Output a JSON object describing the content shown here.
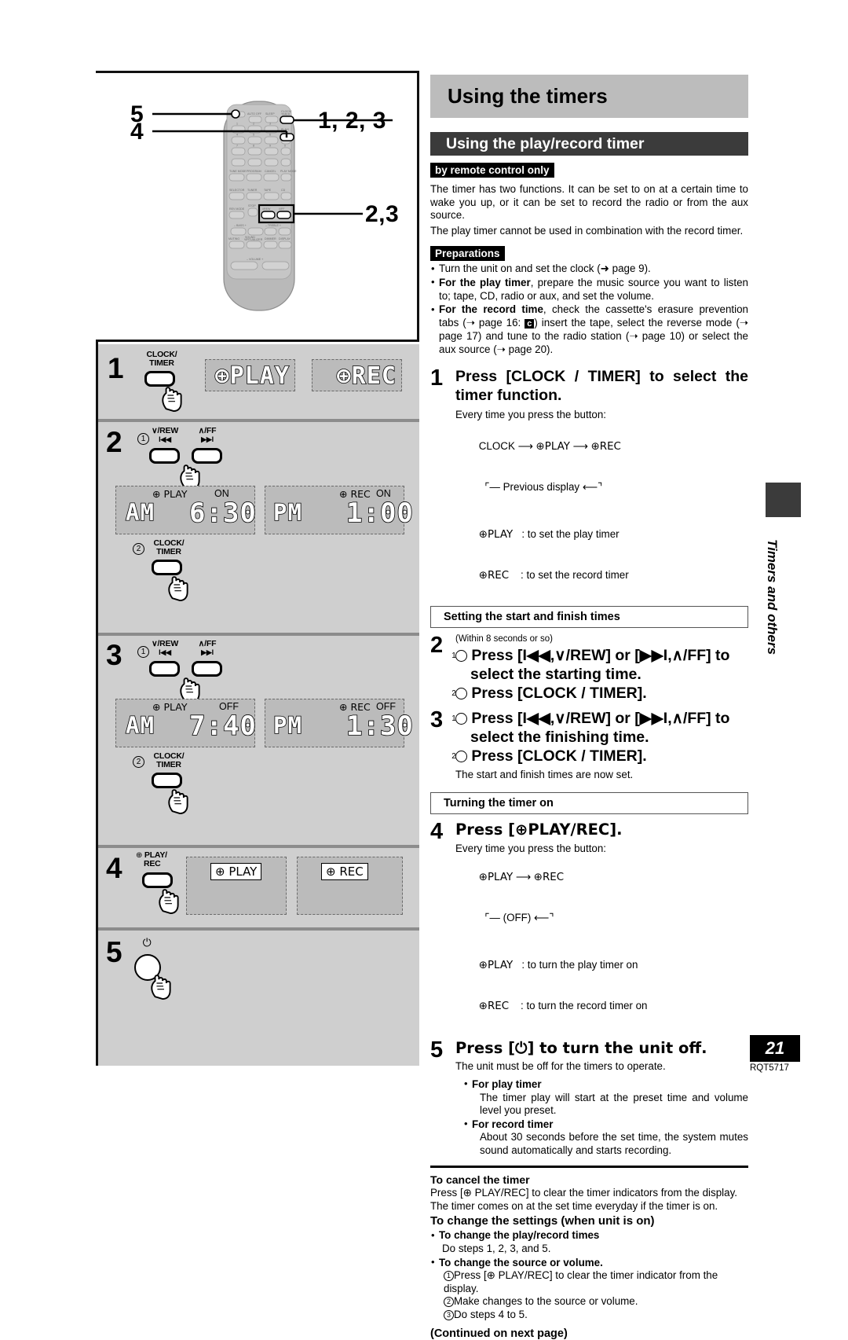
{
  "page": {
    "number": "21",
    "doc_code": "RQT5717",
    "side_tab_label": "Timers and others"
  },
  "header": {
    "title": "Using the timers",
    "subtitle": "Using the play/record timer",
    "badge": "by remote control only"
  },
  "intro": {
    "p1": "The timer has two functions. It can be set to on at a certain time to wake you up, or it can be set to record the radio or from the aux source.",
    "p2": "The play timer cannot be used in combination with the record timer."
  },
  "preparations": {
    "label": "Preparations",
    "items": [
      "Turn the unit on and set the clock (➜ page 9).",
      "For the play timer, prepare the music source you want to listen to; tape, CD, radio or aux, and set the volume.",
      "For the record time, check the cassette's erasure prevention tabs (➜ page 16: c ) insert the tape, select the reverse mode (➜ page 17) and tune to the radio station (➜ page 10) or select the aux source (➜ page 20)."
    ],
    "bold_leads": [
      "",
      "For the play timer",
      "For the record time"
    ]
  },
  "step1": {
    "num": "1",
    "heading": "Press [CLOCK / TIMER] to select the timer function.",
    "note": "Every time you press the button:",
    "cycle_a": "CLOCK",
    "cycle_b": "⊕PLAY",
    "cycle_c": "⊕REC",
    "cycle_back": "Previous display",
    "legend": [
      {
        "key": "⊕PLAY",
        "val": ": to set the play timer"
      },
      {
        "key": "⊕REC",
        "val": ": to set the record timer"
      }
    ]
  },
  "section_times": {
    "header": "Setting the start and finish times"
  },
  "step2": {
    "num": "2",
    "small": "(Within 8 seconds or so)",
    "sub1": "Press [I◀◀,∨/REW] or  [▶▶I,∧/FF] to select the starting time.",
    "sub2": "Press [CLOCK / TIMER]."
  },
  "step3": {
    "num": "3",
    "sub1": "Press [I◀◀,∨/REW] or  [▶▶I,∧/FF] to select the finishing time.",
    "sub2": "Press [CLOCK / TIMER].",
    "note": "The start and finish times are now set."
  },
  "section_turnon": {
    "header": "Turning the timer on"
  },
  "step4": {
    "num": "4",
    "heading": "Press [⊕PLAY/REC].",
    "note": "Every time you press the button:",
    "cycle_a": "⊕PLAY",
    "cycle_b": "⊕REC",
    "cycle_back": "(OFF)",
    "legend": [
      {
        "key": "⊕PLAY",
        "val": ": to turn the play timer on"
      },
      {
        "key": "⊕REC",
        "val": ": to turn the record timer on"
      }
    ]
  },
  "step5": {
    "num": "5",
    "heading": "Press [⏻] to turn the unit off.",
    "note": "The unit must be off for the timers to operate.",
    "bullets": [
      {
        "lead": "For play timer",
        "text": "The timer play will start at the preset time and volume level you preset."
      },
      {
        "lead": "For record timer",
        "text": "About 30 seconds before the set time, the system mutes sound automatically and starts recording."
      }
    ]
  },
  "footer": {
    "cancel_header": "To cancel the timer",
    "cancel_line1": "Press [⊕ PLAY/REC] to clear the timer indicators from the display.",
    "cancel_line2": "The timer comes on at the set time everyday if the timer is on.",
    "change_header": "To change the settings (when unit is on)",
    "b1_lead": "To change the play/record times",
    "b1_text": "Do steps 1, 2, 3, and 5.",
    "b2_lead": "To change the source or volume.",
    "b2_items": [
      "Press [⊕ PLAY/REC] to clear the timer indicator from the display.",
      "Make changes to the source or volume.",
      "Do steps 4 to 5."
    ],
    "continued": "(Continued on next page)"
  },
  "remote": {
    "callouts": {
      "c5": "5",
      "c4": "4",
      "c123": "1, 2, 3",
      "c23": "2,3"
    },
    "labels": {
      "auto_off": "AUTO OFF",
      "sleep": "SLEEP",
      "clock_timer": "CLOCK/\nTIMER",
      "play_rec": "⊕PLAY/\nREC",
      "tune_mode": "TUNE MODE",
      "program": "PROGRAM",
      "cancel": "CANCEL",
      "play_mode": "PLAY MODE",
      "selector": "SELECTOR",
      "tuner": "TUNER",
      "tape": "TAPE◀▶",
      "cd": "CD▶II",
      "rev_mode": "REV MODE",
      "stop": "STOP",
      "rew": "∨/REW",
      "ff": "∧/FF",
      "bass": "– BASS +",
      "treble": "– TREBLE +",
      "muting": "MUTING",
      "sound_virtualizer": "SOUND\nVIRTUALIZER",
      "dimmer": "DIMMER",
      "display": "DISPLAY",
      "volume": "–   VOLUME   +",
      "keys": [
        "1",
        "2",
        "3",
        "4",
        "5",
        "6",
        "7",
        "8",
        "9",
        "0"
      ]
    }
  },
  "steps_diagram": {
    "s1": {
      "num": "1",
      "button_label": "CLOCK/\nTIMER",
      "lcd_left": "⊕PLAY",
      "lcd_right": "⊕REC"
    },
    "s2": {
      "num": "2",
      "sub1": "1",
      "sub2": "2",
      "btn_rew": "∨/REW",
      "btn_rew_icon": "I◀◀",
      "btn_ff": "∧/FF",
      "btn_ff_icon": "▶▶I",
      "button_label": "CLOCK/\nTIMER",
      "lcd_left": {
        "tag": "⊕ PLAY",
        "state": "ON",
        "ampm": "AM",
        "time": "6:30"
      },
      "lcd_right": {
        "tag": "⊕ REC",
        "state": "ON",
        "ampm": "PM",
        "time": "1:00"
      }
    },
    "s3": {
      "num": "3",
      "sub1": "1",
      "sub2": "2",
      "btn_rew": "∨/REW",
      "btn_rew_icon": "I◀◀",
      "btn_ff": "∧/FF",
      "btn_ff_icon": "▶▶I",
      "button_label": "CLOCK/\nTIMER",
      "lcd_left": {
        "tag": "⊕ PLAY",
        "state": "OFF",
        "ampm": "AM",
        "time": "7:40"
      },
      "lcd_right": {
        "tag": "⊕ REC",
        "state": "OFF",
        "ampm": "PM",
        "time": "1:30"
      }
    },
    "s4": {
      "num": "4",
      "button_label": "⊕ PLAY/\nREC",
      "lcd_left": "⊕ PLAY",
      "lcd_right": "⊕ REC"
    },
    "s5": {
      "num": "5",
      "button_label": "⏻"
    }
  }
}
